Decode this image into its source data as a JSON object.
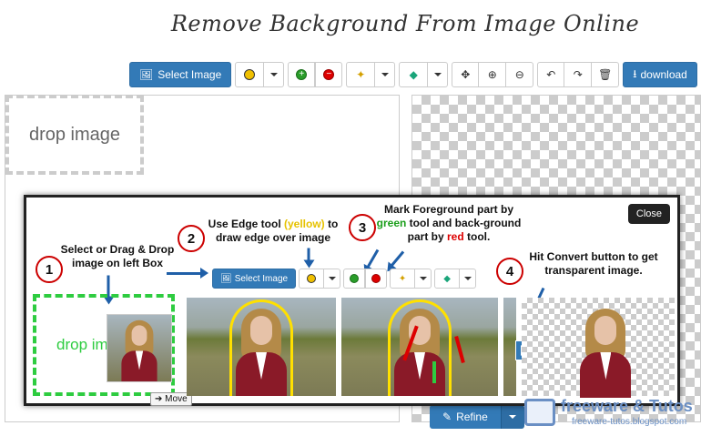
{
  "page": {
    "title": "Remove Background From Image Online"
  },
  "toolbar": {
    "select_image": "Select Image",
    "download": "download",
    "icons": [
      "image-icon",
      "yellow-circle-icon",
      "caret-down-icon",
      "plus-icon",
      "minus-icon",
      "magic-wand-icon",
      "eraser-icon",
      "move-icon",
      "zoom-in-icon",
      "zoom-out-icon",
      "undo-icon",
      "redo-icon",
      "trash-icon",
      "download-icon"
    ]
  },
  "left_panel": {
    "drop_label": "drop image"
  },
  "refine": {
    "label": "Refine"
  },
  "overlay": {
    "close": "Close",
    "steps": [
      {
        "num": "1",
        "text": "Select or Drag & Drop image on left Box"
      },
      {
        "num": "2",
        "text_a": "Use Edge tool ",
        "text_hl": "(yellow)",
        "text_b": " to draw edge over image"
      },
      {
        "num": "3",
        "text_a": "Mark Foreground part by ",
        "text_g": "green",
        "text_b": " tool and back-ground part by ",
        "text_r": "red",
        "text_c": " tool."
      },
      {
        "num": "4",
        "text": "Hit Convert button to get transparent image."
      }
    ],
    "mini_select": "Select Image",
    "mini_drop": "drop image",
    "move": "Move"
  },
  "watermark": {
    "title": "freeware & Tutos",
    "url": "freeware-tutos.blogspot.com"
  },
  "colors": {
    "primary": "#337ab7",
    "yellow": "#ffe000",
    "green": "#2ecc40",
    "red": "#dd0000"
  }
}
